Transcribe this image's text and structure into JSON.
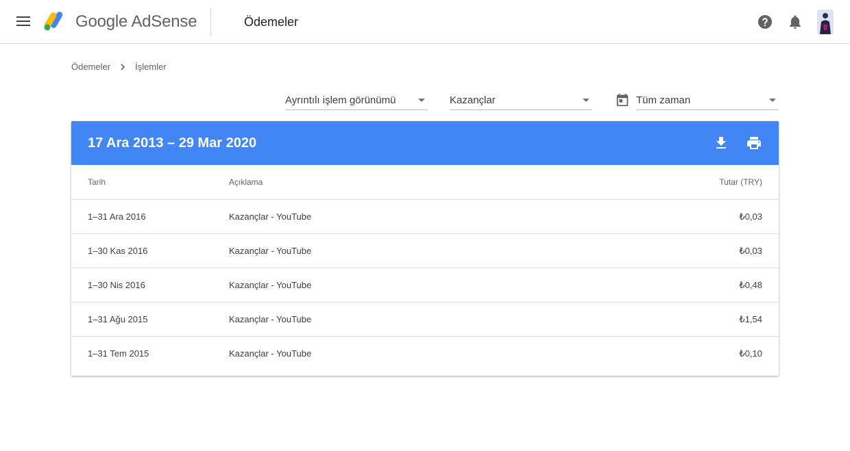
{
  "header": {
    "brand": "Google AdSense",
    "section_title": "Ödemeler",
    "icons": {
      "menu": "menu-icon",
      "help": "help-icon",
      "notifications": "bell-icon"
    }
  },
  "breadcrumb": {
    "items": [
      "Ödemeler",
      "İşlemler"
    ]
  },
  "filters": {
    "view": "Ayrıntılı işlem görünümü",
    "type": "Kazançlar",
    "range": "Tüm zaman"
  },
  "card": {
    "title": "17 Ara 2013 – 29 Mar 2020",
    "header_color": "#4285f4",
    "columns": {
      "date": "Tarih",
      "description": "Açıklama",
      "amount": "Tutar (TRY)"
    },
    "rows": [
      {
        "date": "1–31 Ara 2016",
        "description": "Kazançlar - YouTube",
        "amount": "₺0,03"
      },
      {
        "date": "1–30 Kas 2016",
        "description": "Kazançlar - YouTube",
        "amount": "₺0,03"
      },
      {
        "date": "1–30 Nis 2016",
        "description": "Kazançlar - YouTube",
        "amount": "₺0,48"
      },
      {
        "date": "1–31 Ağu 2015",
        "description": "Kazançlar - YouTube",
        "amount": "₺1,54"
      },
      {
        "date": "1–31 Tem 2015",
        "description": "Kazançlar - YouTube",
        "amount": "₺0,10"
      }
    ]
  }
}
